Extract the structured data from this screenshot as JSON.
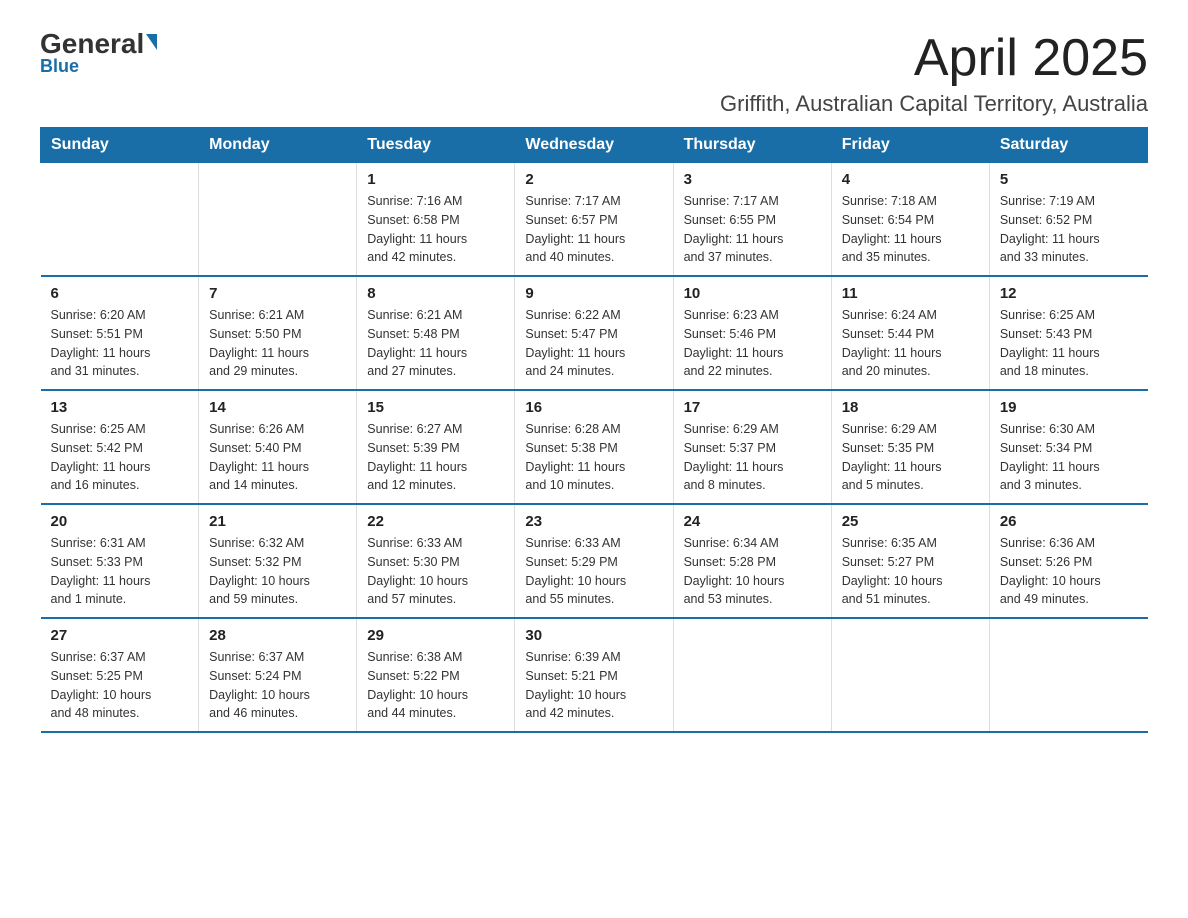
{
  "logo": {
    "name_black": "General",
    "name_blue": "Blue",
    "arrow_desc": "blue arrow"
  },
  "header": {
    "month_year": "April 2025",
    "location": "Griffith, Australian Capital Territory, Australia"
  },
  "days_of_week": [
    "Sunday",
    "Monday",
    "Tuesday",
    "Wednesday",
    "Thursday",
    "Friday",
    "Saturday"
  ],
  "weeks": [
    [
      {
        "day": "",
        "info": ""
      },
      {
        "day": "",
        "info": ""
      },
      {
        "day": "1",
        "info": "Sunrise: 7:16 AM\nSunset: 6:58 PM\nDaylight: 11 hours\nand 42 minutes."
      },
      {
        "day": "2",
        "info": "Sunrise: 7:17 AM\nSunset: 6:57 PM\nDaylight: 11 hours\nand 40 minutes."
      },
      {
        "day": "3",
        "info": "Sunrise: 7:17 AM\nSunset: 6:55 PM\nDaylight: 11 hours\nand 37 minutes."
      },
      {
        "day": "4",
        "info": "Sunrise: 7:18 AM\nSunset: 6:54 PM\nDaylight: 11 hours\nand 35 minutes."
      },
      {
        "day": "5",
        "info": "Sunrise: 7:19 AM\nSunset: 6:52 PM\nDaylight: 11 hours\nand 33 minutes."
      }
    ],
    [
      {
        "day": "6",
        "info": "Sunrise: 6:20 AM\nSunset: 5:51 PM\nDaylight: 11 hours\nand 31 minutes."
      },
      {
        "day": "7",
        "info": "Sunrise: 6:21 AM\nSunset: 5:50 PM\nDaylight: 11 hours\nand 29 minutes."
      },
      {
        "day": "8",
        "info": "Sunrise: 6:21 AM\nSunset: 5:48 PM\nDaylight: 11 hours\nand 27 minutes."
      },
      {
        "day": "9",
        "info": "Sunrise: 6:22 AM\nSunset: 5:47 PM\nDaylight: 11 hours\nand 24 minutes."
      },
      {
        "day": "10",
        "info": "Sunrise: 6:23 AM\nSunset: 5:46 PM\nDaylight: 11 hours\nand 22 minutes."
      },
      {
        "day": "11",
        "info": "Sunrise: 6:24 AM\nSunset: 5:44 PM\nDaylight: 11 hours\nand 20 minutes."
      },
      {
        "day": "12",
        "info": "Sunrise: 6:25 AM\nSunset: 5:43 PM\nDaylight: 11 hours\nand 18 minutes."
      }
    ],
    [
      {
        "day": "13",
        "info": "Sunrise: 6:25 AM\nSunset: 5:42 PM\nDaylight: 11 hours\nand 16 minutes."
      },
      {
        "day": "14",
        "info": "Sunrise: 6:26 AM\nSunset: 5:40 PM\nDaylight: 11 hours\nand 14 minutes."
      },
      {
        "day": "15",
        "info": "Sunrise: 6:27 AM\nSunset: 5:39 PM\nDaylight: 11 hours\nand 12 minutes."
      },
      {
        "day": "16",
        "info": "Sunrise: 6:28 AM\nSunset: 5:38 PM\nDaylight: 11 hours\nand 10 minutes."
      },
      {
        "day": "17",
        "info": "Sunrise: 6:29 AM\nSunset: 5:37 PM\nDaylight: 11 hours\nand 8 minutes."
      },
      {
        "day": "18",
        "info": "Sunrise: 6:29 AM\nSunset: 5:35 PM\nDaylight: 11 hours\nand 5 minutes."
      },
      {
        "day": "19",
        "info": "Sunrise: 6:30 AM\nSunset: 5:34 PM\nDaylight: 11 hours\nand 3 minutes."
      }
    ],
    [
      {
        "day": "20",
        "info": "Sunrise: 6:31 AM\nSunset: 5:33 PM\nDaylight: 11 hours\nand 1 minute."
      },
      {
        "day": "21",
        "info": "Sunrise: 6:32 AM\nSunset: 5:32 PM\nDaylight: 10 hours\nand 59 minutes."
      },
      {
        "day": "22",
        "info": "Sunrise: 6:33 AM\nSunset: 5:30 PM\nDaylight: 10 hours\nand 57 minutes."
      },
      {
        "day": "23",
        "info": "Sunrise: 6:33 AM\nSunset: 5:29 PM\nDaylight: 10 hours\nand 55 minutes."
      },
      {
        "day": "24",
        "info": "Sunrise: 6:34 AM\nSunset: 5:28 PM\nDaylight: 10 hours\nand 53 minutes."
      },
      {
        "day": "25",
        "info": "Sunrise: 6:35 AM\nSunset: 5:27 PM\nDaylight: 10 hours\nand 51 minutes."
      },
      {
        "day": "26",
        "info": "Sunrise: 6:36 AM\nSunset: 5:26 PM\nDaylight: 10 hours\nand 49 minutes."
      }
    ],
    [
      {
        "day": "27",
        "info": "Sunrise: 6:37 AM\nSunset: 5:25 PM\nDaylight: 10 hours\nand 48 minutes."
      },
      {
        "day": "28",
        "info": "Sunrise: 6:37 AM\nSunset: 5:24 PM\nDaylight: 10 hours\nand 46 minutes."
      },
      {
        "day": "29",
        "info": "Sunrise: 6:38 AM\nSunset: 5:22 PM\nDaylight: 10 hours\nand 44 minutes."
      },
      {
        "day": "30",
        "info": "Sunrise: 6:39 AM\nSunset: 5:21 PM\nDaylight: 10 hours\nand 42 minutes."
      },
      {
        "day": "",
        "info": ""
      },
      {
        "day": "",
        "info": ""
      },
      {
        "day": "",
        "info": ""
      }
    ]
  ]
}
